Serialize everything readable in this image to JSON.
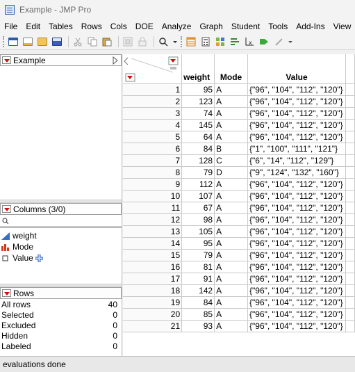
{
  "window": {
    "title": "Example - JMP Pro"
  },
  "menu": [
    "File",
    "Edit",
    "Tables",
    "Rows",
    "Cols",
    "DOE",
    "Analyze",
    "Graph",
    "Student",
    "Tools",
    "Add-Ins",
    "View"
  ],
  "toolbar_icons": [
    "new-table-icon",
    "new-script-icon",
    "open-icon",
    "save-icon",
    "cut-icon",
    "copy-icon",
    "paste-icon",
    "add-in-icon",
    "lock-icon",
    "search-icon",
    "data-table-icon",
    "calculator-icon",
    "distribution-icon",
    "graph-builder-icon",
    "formula-icon",
    "annotate-icon"
  ],
  "left": {
    "table_name": "Example",
    "columns_header": "Columns (3/0)",
    "search_placeholder": "",
    "columns": [
      {
        "name": "weight",
        "icon": "continuous-icon"
      },
      {
        "name": "Mode",
        "icon": "nominal-icon"
      },
      {
        "name": "Value",
        "icon": "expression-icon"
      }
    ],
    "rows_header": "Rows",
    "rows_summary": [
      {
        "label": "All rows",
        "value": "40"
      },
      {
        "label": "Selected",
        "value": "0"
      },
      {
        "label": "Excluded",
        "value": "0"
      },
      {
        "label": "Hidden",
        "value": "0"
      },
      {
        "label": "Labeled",
        "value": "0"
      }
    ]
  },
  "table": {
    "headers": [
      "weight",
      "Mode",
      "Value"
    ],
    "rows": [
      [
        "1",
        "95",
        "A",
        "{\"96\", \"104\", \"112\", \"120\"}"
      ],
      [
        "2",
        "123",
        "A",
        "{\"96\", \"104\", \"112\", \"120\"}"
      ],
      [
        "3",
        "74",
        "A",
        "{\"96\", \"104\", \"112\", \"120\"}"
      ],
      [
        "4",
        "145",
        "A",
        "{\"96\", \"104\", \"112\", \"120\"}"
      ],
      [
        "5",
        "64",
        "A",
        "{\"96\", \"104\", \"112\", \"120\"}"
      ],
      [
        "6",
        "84",
        "B",
        "{\"1\", \"100\", \"111\", \"121\"}"
      ],
      [
        "7",
        "128",
        "C",
        "{\"6\", \"14\", \"112\", \"129\"}"
      ],
      [
        "8",
        "79",
        "D",
        "{\"9\", \"124\", \"132\", \"160\"}"
      ],
      [
        "9",
        "112",
        "A",
        "{\"96\", \"104\", \"112\", \"120\"}"
      ],
      [
        "10",
        "107",
        "A",
        "{\"96\", \"104\", \"112\", \"120\"}"
      ],
      [
        "11",
        "67",
        "A",
        "{\"96\", \"104\", \"112\", \"120\"}"
      ],
      [
        "12",
        "98",
        "A",
        "{\"96\", \"104\", \"112\", \"120\"}"
      ],
      [
        "13",
        "105",
        "A",
        "{\"96\", \"104\", \"112\", \"120\"}"
      ],
      [
        "14",
        "95",
        "A",
        "{\"96\", \"104\", \"112\", \"120\"}"
      ],
      [
        "15",
        "79",
        "A",
        "{\"96\", \"104\", \"112\", \"120\"}"
      ],
      [
        "16",
        "81",
        "A",
        "{\"96\", \"104\", \"112\", \"120\"}"
      ],
      [
        "17",
        "91",
        "A",
        "{\"96\", \"104\", \"112\", \"120\"}"
      ],
      [
        "18",
        "142",
        "A",
        "{\"96\", \"104\", \"112\", \"120\"}"
      ],
      [
        "19",
        "84",
        "A",
        "{\"96\", \"104\", \"112\", \"120\"}"
      ],
      [
        "20",
        "85",
        "A",
        "{\"96\", \"104\", \"112\", \"120\"}"
      ],
      [
        "21",
        "93",
        "A",
        "{\"96\", \"104\", \"112\", \"120\"}"
      ]
    ]
  },
  "status": {
    "text": "evaluations done"
  }
}
